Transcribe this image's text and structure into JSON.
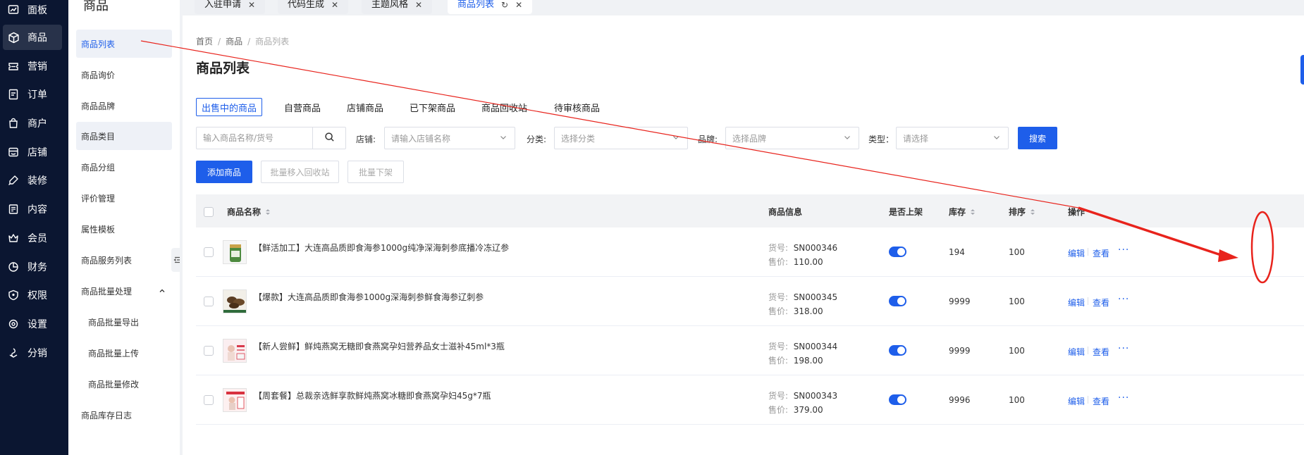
{
  "sidebar": {
    "items": [
      {
        "label": "面板",
        "icon": "dashboard-icon"
      },
      {
        "label": "商品",
        "icon": "cube-icon"
      },
      {
        "label": "营销",
        "icon": "ticket-icon"
      },
      {
        "label": "订单",
        "icon": "order-icon"
      },
      {
        "label": "商户",
        "icon": "bag-icon"
      },
      {
        "label": "店铺",
        "icon": "store-icon"
      },
      {
        "label": "装修",
        "icon": "brush-icon"
      },
      {
        "label": "内容",
        "icon": "document-icon"
      },
      {
        "label": "会员",
        "icon": "crown-icon"
      },
      {
        "label": "财务",
        "icon": "pie-chart-icon"
      },
      {
        "label": "权限",
        "icon": "shield-icon"
      },
      {
        "label": "设置",
        "icon": "gear-icon"
      },
      {
        "label": "分销",
        "icon": "share-icon"
      }
    ]
  },
  "submenu": {
    "title": "商品",
    "items": [
      {
        "label": "商品列表"
      },
      {
        "label": "商品询价"
      },
      {
        "label": "商品品牌"
      },
      {
        "label": "商品类目"
      },
      {
        "label": "商品分组"
      },
      {
        "label": "评价管理"
      },
      {
        "label": "属性模板"
      },
      {
        "label": "商品服务列表"
      },
      {
        "label": "商品批量处理"
      },
      {
        "label": "商品批量导出"
      },
      {
        "label": "商品批量上传"
      },
      {
        "label": "商品批量修改"
      },
      {
        "label": "商品库存日志"
      }
    ]
  },
  "tabs": [
    {
      "label": "入驻申请"
    },
    {
      "label": "代码生成"
    },
    {
      "label": "主题风格"
    },
    {
      "label": "商品列表"
    }
  ],
  "breadcrumb": {
    "home": "首页",
    "parent": "商品",
    "current": "商品列表"
  },
  "page_title": "商品列表",
  "status_tabs": [
    {
      "label": "出售中的商品"
    },
    {
      "label": "自营商品"
    },
    {
      "label": "店铺商品"
    },
    {
      "label": "已下架商品"
    },
    {
      "label": "商品回收站"
    },
    {
      "label": "待审核商品"
    }
  ],
  "filters": {
    "search_placeholder": "输入商品名称/货号",
    "shop_label": "店铺:",
    "shop_placeholder": "请输入店铺名称",
    "category_label": "分类:",
    "category_placeholder": "选择分类",
    "brand_label": "品牌:",
    "brand_placeholder": "选择品牌",
    "type_label": "类型：",
    "type_placeholder": "请选择",
    "search_button": "搜索"
  },
  "actions": {
    "add": "添加商品",
    "move_to_recycle": "批量移入回收站",
    "batch_unlist": "批量下架"
  },
  "table": {
    "headers": {
      "name": "商品名称",
      "info": "商品信息",
      "listed": "是否上架",
      "stock": "库存",
      "sort": "排序",
      "ops": "操作"
    },
    "sku_key": "货号:",
    "price_key": "售价:",
    "edit": "编辑",
    "view": "查看",
    "more": "···",
    "rows": [
      {
        "name": "【鲜活加工】大连高品质即食海参1000g纯净深海刺参底播冷冻辽参",
        "sku": "SN000346",
        "price": "110.00",
        "stock": "194",
        "sort": "100"
      },
      {
        "name": "【爆款】大连高品质即食海参1000g深海刺参鲜食海参辽刺参",
        "sku": "SN000345",
        "price": "318.00",
        "stock": "9999",
        "sort": "100"
      },
      {
        "name": "【新人尝鲜】鲜炖燕窝无糖即食燕窝孕妇营养品女士滋补45ml*3瓶",
        "sku": "SN000344",
        "price": "198.00",
        "stock": "9999",
        "sort": "100"
      },
      {
        "name": "【周套餐】总裁亲选鲜享款鲜炖燕窝冰糖即食燕窝孕妇45g*7瓶",
        "sku": "SN000343",
        "price": "379.00",
        "stock": "9996",
        "sort": "100"
      }
    ]
  },
  "colors": {
    "primary": "#1e5eea",
    "sidebar_bg": "#0b1631",
    "annotation": "#e8231c"
  }
}
